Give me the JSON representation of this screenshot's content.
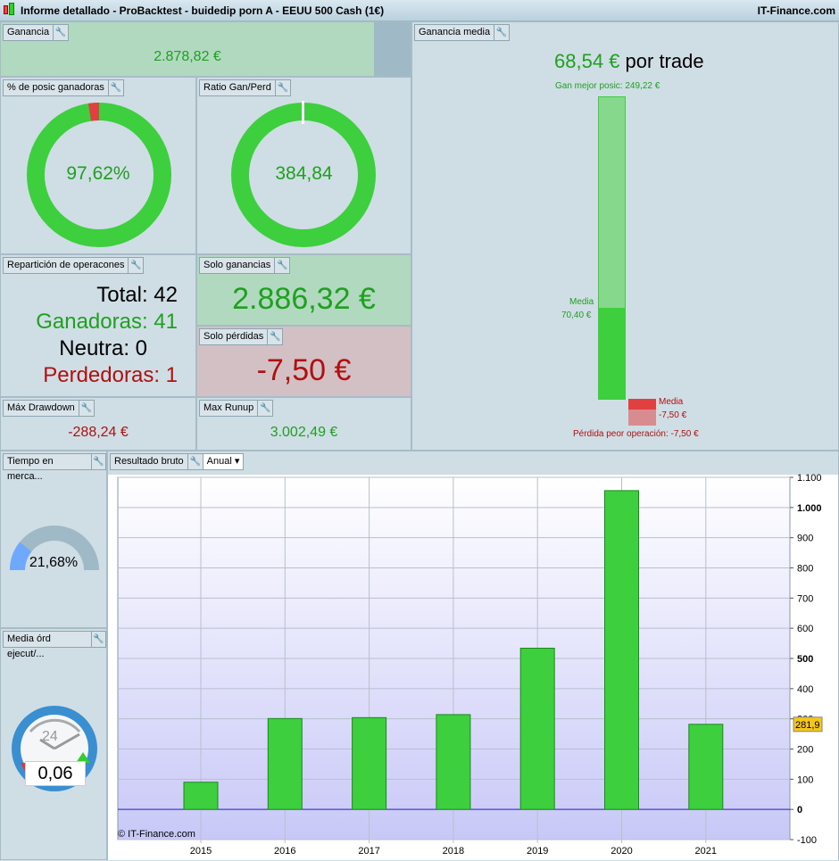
{
  "title": "Informe detallado - ProBacktest - buidedip porn A - EEUU 500 Cash (1€)",
  "brand": "IT-Finance.com",
  "ganancia": {
    "label": "Ganancia",
    "value": "2.878,82 €"
  },
  "pct_ganadoras": {
    "label": "% de posic ganadoras",
    "value": "97,62%",
    "fraction": 0.9762
  },
  "ratio": {
    "label": "Ratio Gan/Perd",
    "value": "384,84"
  },
  "reparticion": {
    "label": "Repartición de operacones",
    "total": "Total: 42",
    "ganadoras": "Ganadoras: 41",
    "neutra": "Neutra: 0",
    "perdedoras": "Perdedoras: 1"
  },
  "solo_ganancias": {
    "label": "Solo ganancias",
    "value": "2.886,32 €"
  },
  "solo_perdidas": {
    "label": "Solo pérdidas",
    "value": "-7,50 €"
  },
  "drawdown": {
    "label": "Máx Drawdown",
    "value": "-288,24 €"
  },
  "runup": {
    "label": "Max Runup",
    "value": "3.002,49 €"
  },
  "ganancia_media": {
    "label": "Ganancia media",
    "value": "68,54 €",
    "suffix": "por trade",
    "mejor": "Gan mejor posic: 249,22 €",
    "media_label": "Media",
    "media_gan": "70,40 €",
    "media_perd_label": "Media",
    "media_perd": "-7,50 €",
    "peor": "Pérdida peor operación: -7,50 €"
  },
  "tiempo": {
    "label": "Tiempo en merca...",
    "value": "21,68%",
    "fraction": 0.2168
  },
  "media_ord": {
    "label": "Media órd ejecut/...",
    "value": "0,06",
    "clock": "24"
  },
  "resultado": {
    "label": "Resultado bruto",
    "period": "Anual",
    "copyright": "© IT-Finance.com"
  },
  "chart_data": {
    "type": "bar",
    "categories": [
      "2015",
      "2016",
      "2017",
      "2018",
      "2019",
      "2020",
      "2021"
    ],
    "values": [
      90,
      301,
      304,
      314,
      534,
      1056,
      281.9
    ],
    "ylim": [
      -100,
      1100
    ],
    "yticks": [
      "-100",
      "0",
      "100",
      "200",
      "300",
      "400",
      "500",
      "600",
      "700",
      "800",
      "900",
      "1.000",
      "1.100"
    ],
    "ytick_values": [
      -100,
      0,
      100,
      200,
      300,
      400,
      500,
      600,
      700,
      800,
      900,
      1000,
      1100
    ],
    "last_value_label": "281,9",
    "bar_color": "#3ecf3e",
    "grid": true
  }
}
